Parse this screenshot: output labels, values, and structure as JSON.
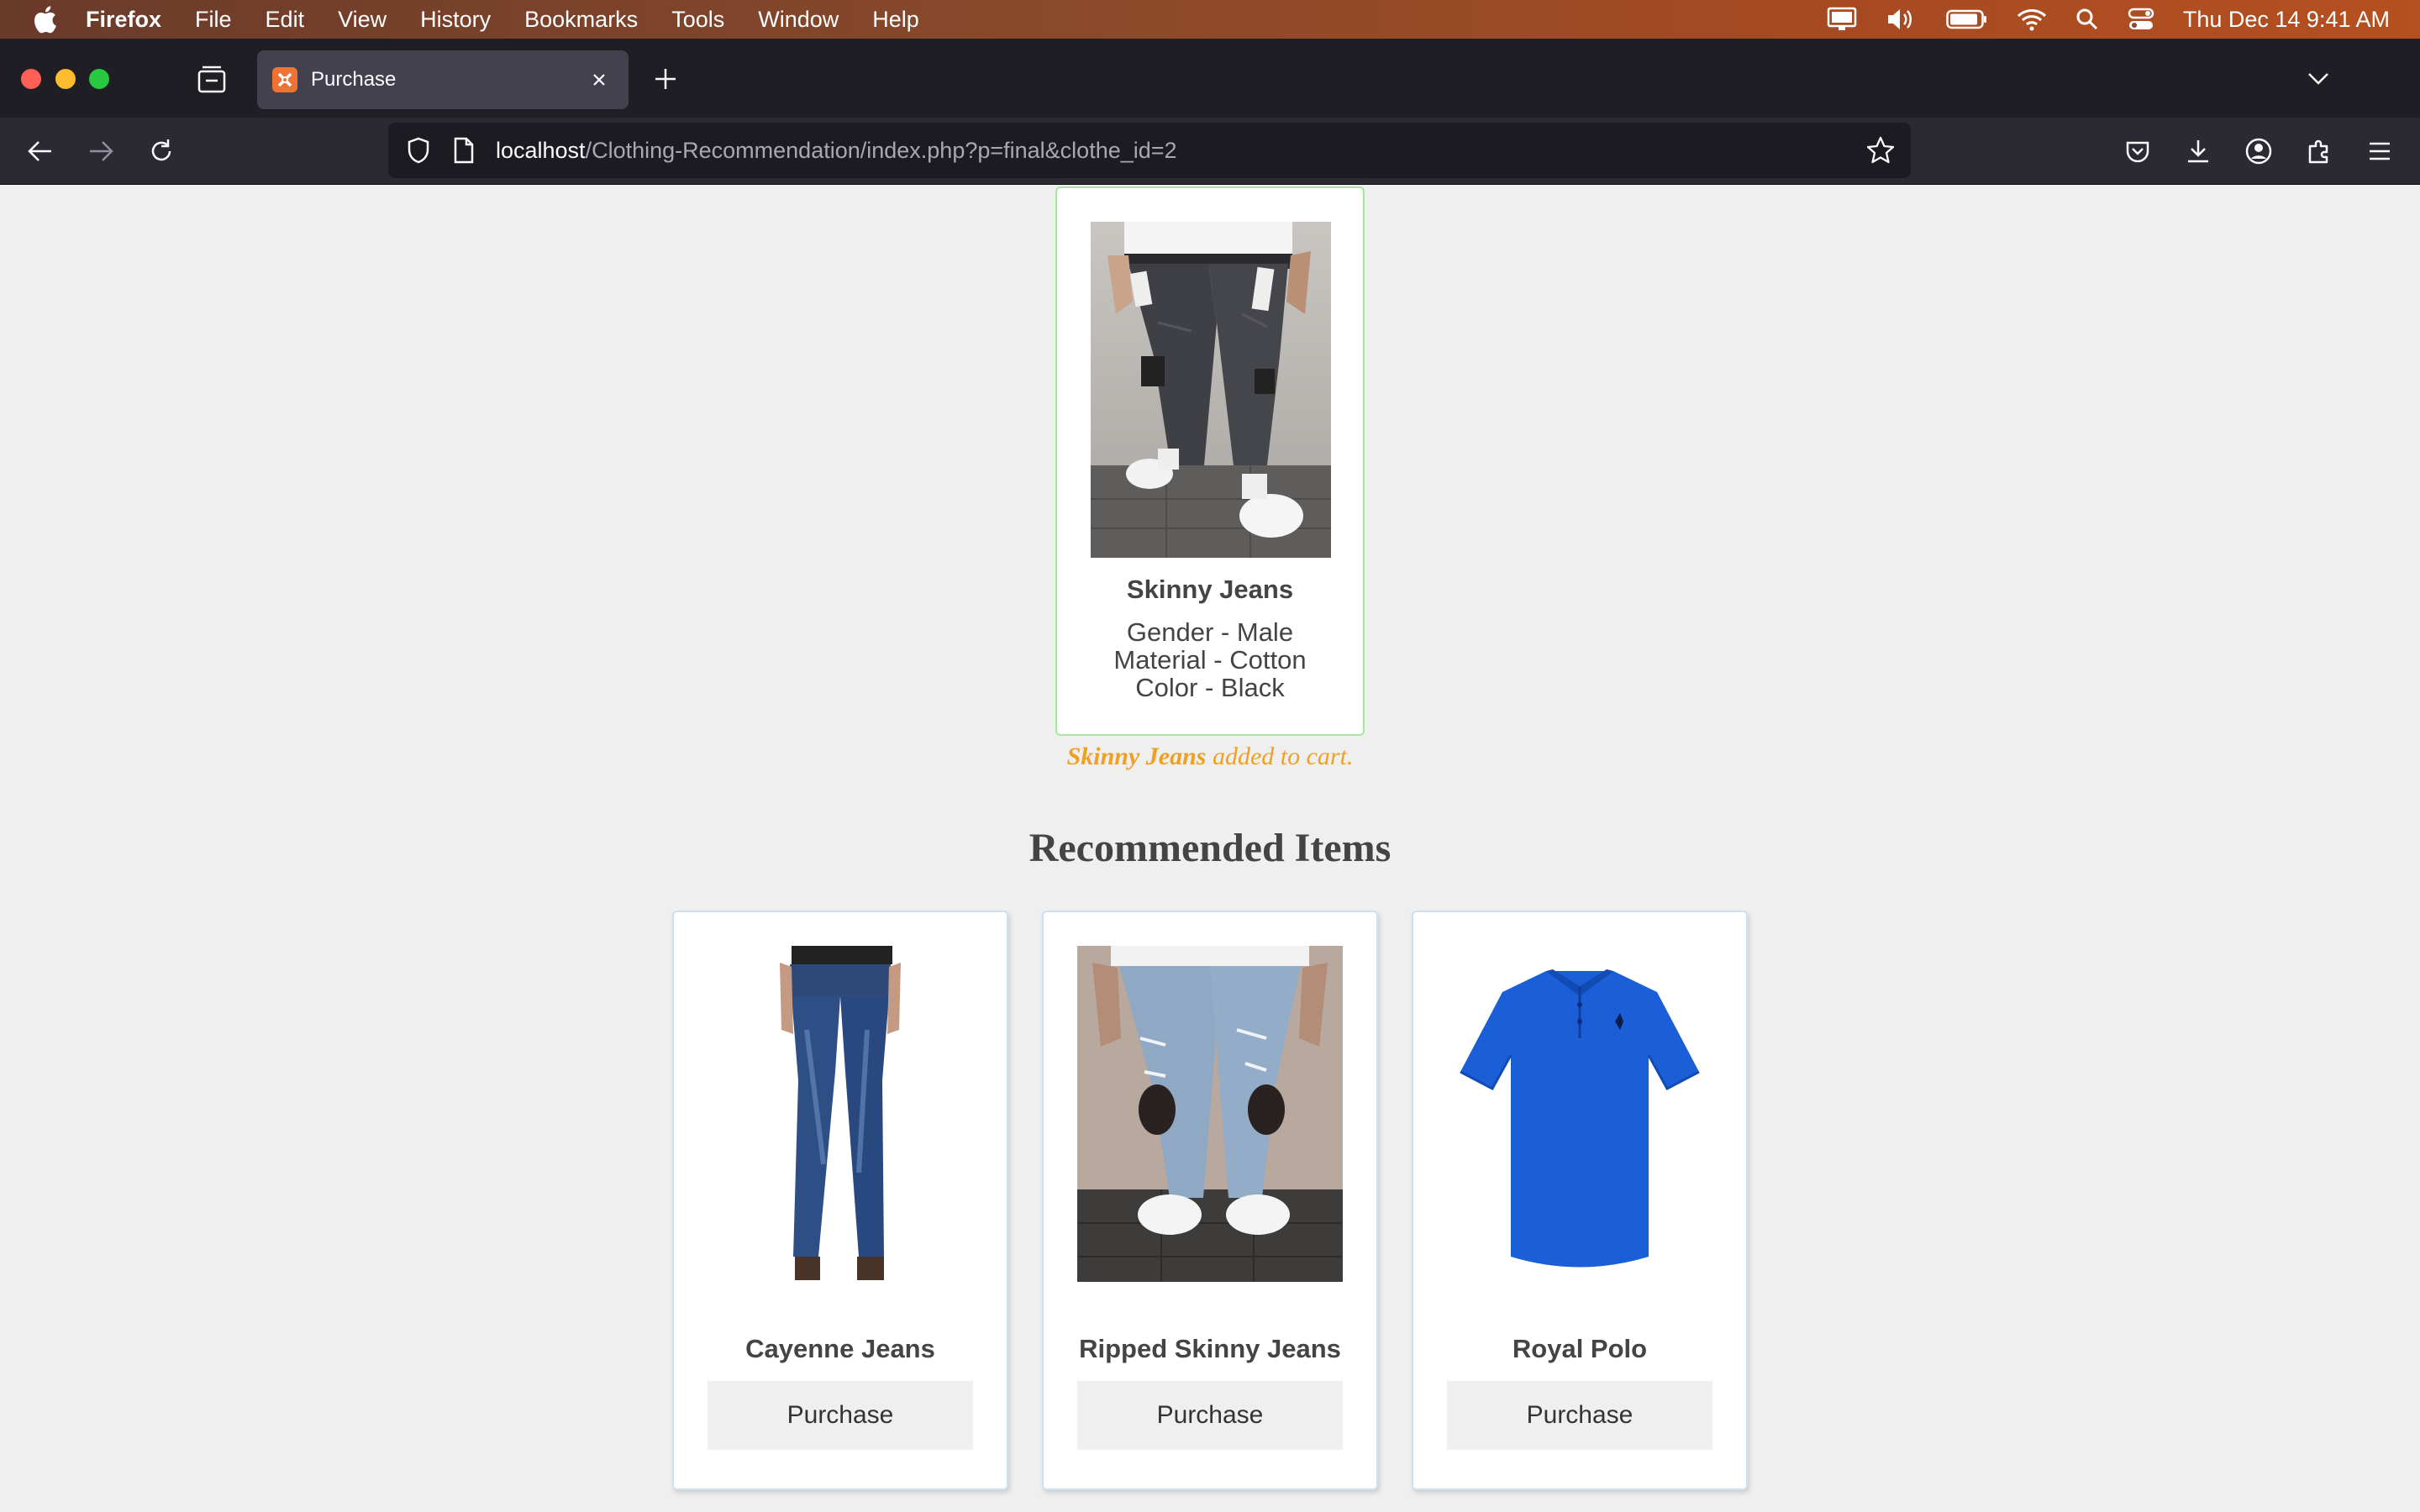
{
  "menubar": {
    "app": "Firefox",
    "items": [
      "File",
      "Edit",
      "View",
      "History",
      "Bookmarks",
      "Tools",
      "Window",
      "Help"
    ],
    "clock": "Thu Dec 14  9:41 AM"
  },
  "browser": {
    "tab_title": "Purchase",
    "url_host": "localhost",
    "url_path": "/Clothing-Recommendation/index.php?p=final&clothe_id=2"
  },
  "featured": {
    "name": "Skinny Jeans",
    "gender": "Gender - Male",
    "material": "Material - Cotton",
    "color": "Color - Black"
  },
  "cart_message": {
    "item": "Skinny Jeans",
    "suffix": "added to cart."
  },
  "recommended": {
    "heading": "Recommended Items",
    "items": [
      {
        "name": "Cayenne Jeans",
        "button": "Purchase"
      },
      {
        "name": "Ripped Skinny Jeans",
        "button": "Purchase"
      },
      {
        "name": "Royal Polo",
        "button": "Purchase"
      }
    ]
  },
  "colors": {
    "cart_message": "#f0a020",
    "featured_border": "#a8e6a0",
    "polo": "#1a5ed8"
  }
}
